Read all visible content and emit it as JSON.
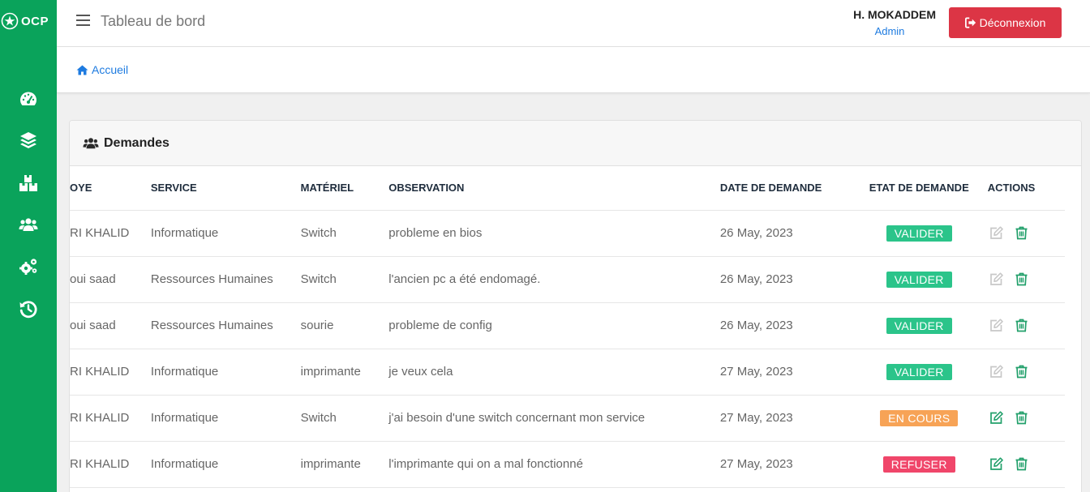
{
  "brand": {
    "logo_text": "OCP",
    "accent": "#0aa35b"
  },
  "sidebar": {
    "items": [
      {
        "icon": "gauge-icon"
      },
      {
        "icon": "layers-icon"
      },
      {
        "icon": "boxes-icon"
      },
      {
        "icon": "users-icon"
      },
      {
        "icon": "cogs-icon"
      },
      {
        "icon": "history-icon"
      }
    ]
  },
  "header": {
    "title": "Tableau de bord",
    "user_name": "H. MOKADDEM",
    "user_role": "Admin",
    "logout_label": "Déconnexion"
  },
  "breadcrumb": {
    "home_label": "Accueil"
  },
  "card": {
    "title": "Demandes"
  },
  "table": {
    "columns": [
      "OYE",
      "SERVICE",
      "MATÉRIEL",
      "OBSERVATION",
      "DATE DE DEMANDE",
      "ETAT DE DEMANDE",
      "ACTIONS"
    ],
    "rows": [
      {
        "employe": "RI KHALID",
        "service": "Informatique",
        "materiel": "Switch",
        "observation": "probleme en bios",
        "date": "26 May, 2023",
        "etat": "VALIDER",
        "etat_color": "#2bc48a",
        "edit_enabled": false
      },
      {
        "employe": "oui saad",
        "service": "Ressources Humaines",
        "materiel": "Switch",
        "observation": "l'ancien pc a été endomagé.",
        "date": "26 May, 2023",
        "etat": "VALIDER",
        "etat_color": "#2bc48a",
        "edit_enabled": false
      },
      {
        "employe": "oui saad",
        "service": "Ressources Humaines",
        "materiel": "sourie",
        "observation": "probleme de config",
        "date": "26 May, 2023",
        "etat": "VALIDER",
        "etat_color": "#2bc48a",
        "edit_enabled": false
      },
      {
        "employe": "RI KHALID",
        "service": "Informatique",
        "materiel": "imprimante",
        "observation": "je veux cela",
        "date": "27 May, 2023",
        "etat": "VALIDER",
        "etat_color": "#2bc48a",
        "edit_enabled": false
      },
      {
        "employe": "RI KHALID",
        "service": "Informatique",
        "materiel": "Switch",
        "observation": "j'ai besoin d'une switch concernant mon service",
        "date": "27 May, 2023",
        "etat": "EN COURS",
        "etat_color": "#f7a356",
        "edit_enabled": true
      },
      {
        "employe": "RI KHALID",
        "service": "Informatique",
        "materiel": "imprimante",
        "observation": "l'imprimante qui on a mal fonctionné",
        "date": "27 May, 2023",
        "etat": "REFUSER",
        "etat_color": "#f0466a",
        "edit_enabled": true
      }
    ]
  }
}
